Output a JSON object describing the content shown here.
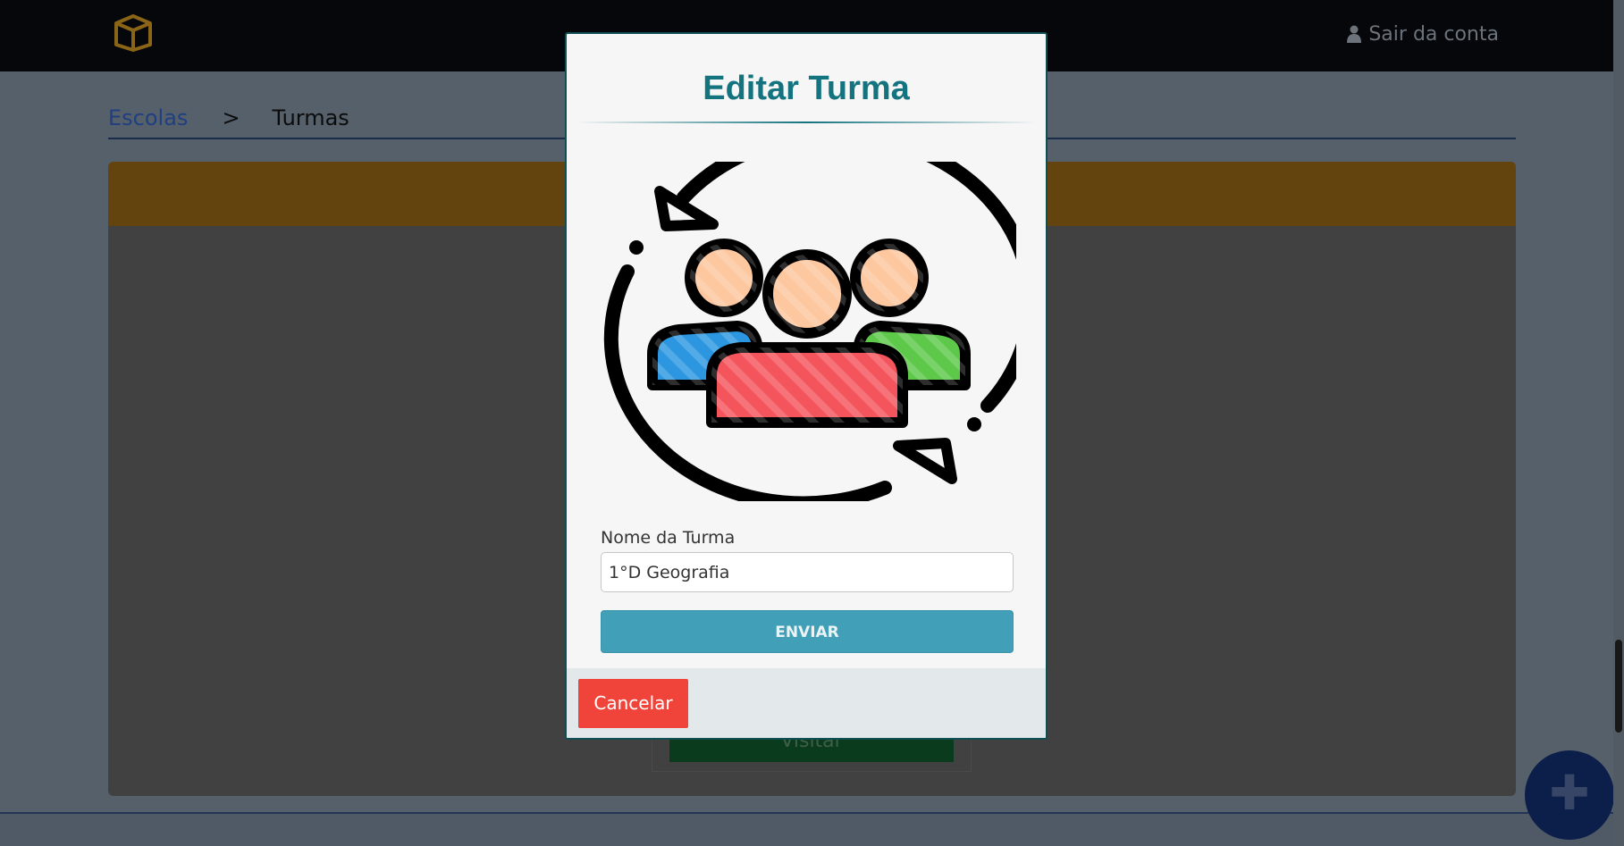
{
  "navbar": {
    "logo_icon": "box-icon",
    "logout_icon": "user-icon",
    "logout_label": "Sair da conta"
  },
  "breadcrumb": {
    "items": [
      "Escolas",
      ">",
      "Turmas"
    ]
  },
  "card": {
    "visit_label": "Visitar"
  },
  "fab": {
    "icon": "plus-icon",
    "label": "✚"
  },
  "modal": {
    "title": "Editar Turma",
    "illustration_icon": "group-sync-icon",
    "field_label": "Nome da Turma",
    "field_value": "1°D Geografia",
    "submit_label": "ENVIAR",
    "cancel_label": "Cancelar"
  },
  "colors": {
    "navbar": "#05070a",
    "title": "#13737f",
    "submit": "#41a0b7",
    "cancel": "#f0433a",
    "card_header": "#63440f"
  }
}
